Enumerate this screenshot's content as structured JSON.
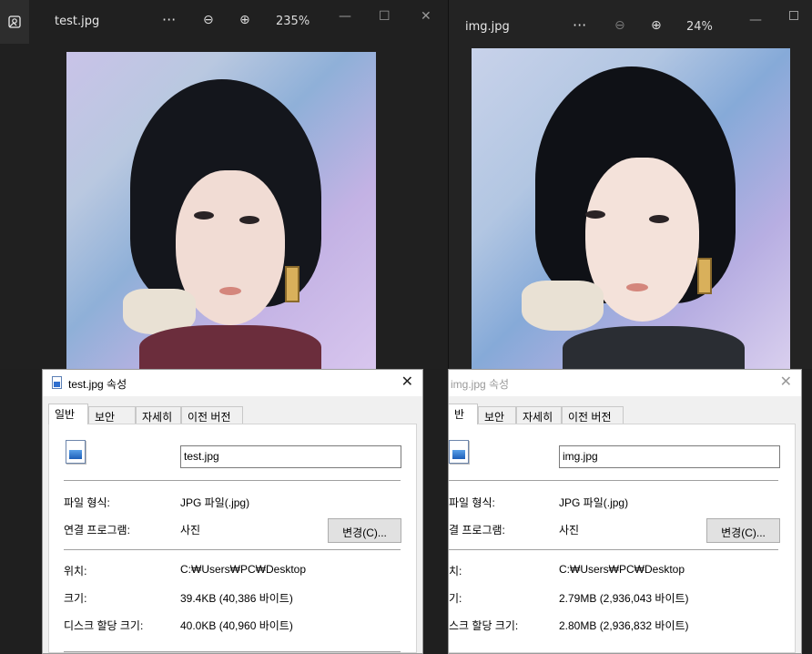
{
  "left_viewer": {
    "filename": "test.jpg",
    "more": "···",
    "zoom_out": "⊖",
    "zoom_in": "⊕",
    "zoom_level": "235%",
    "minimize": "—",
    "maximize": "☐",
    "close": "✕"
  },
  "right_viewer": {
    "filename": "img.jpg",
    "more": "···",
    "zoom_out": "⊖",
    "zoom_in": "⊕",
    "zoom_level": "24%",
    "minimize": "—"
  },
  "left_dialog": {
    "title": "test.jpg 속성",
    "close": "✕",
    "tabs": [
      "일반",
      "보안",
      "자세히",
      "이전 버전"
    ],
    "filename": "test.jpg",
    "rows": {
      "type_label": "파일 형식:",
      "type_value": "JPG 파일(.jpg)",
      "opens_label": "연결 프로그램:",
      "opens_value": "사진",
      "change_button": "변경(C)...",
      "location_label": "위치:",
      "location_value": "C:₩Users₩PC₩Desktop",
      "size_label": "크기:",
      "size_value": "39.4KB (40,386 바이트)",
      "disk_label": "디스크 할당 크기:",
      "disk_value": "40.0KB (40,960 바이트)"
    }
  },
  "right_dialog": {
    "title": "img.jpg 속성",
    "close": "✕",
    "tabs": [
      "반",
      "보안",
      "자세히",
      "이전 버전"
    ],
    "filename": "img.jpg",
    "rows": {
      "type_label": "파일 형식:",
      "type_value": "JPG 파일(.jpg)",
      "opens_label": "결 프로그램:",
      "opens_value": "사진",
      "change_button": "변경(C)...",
      "location_label": "치:",
      "location_value": "C:₩Users₩PC₩Desktop",
      "size_label": "기:",
      "size_value": "2.79MB (2,936,043 바이트)",
      "disk_label": "스크 할당 크기:",
      "disk_value": "2.80MB (2,936,832 바이트)"
    }
  },
  "colors": {
    "viewer_bg": "#202020",
    "dialog_bg": "#f0f0f0",
    "panel_bg": "#ffffff",
    "text_light": "#e8e8e8"
  }
}
